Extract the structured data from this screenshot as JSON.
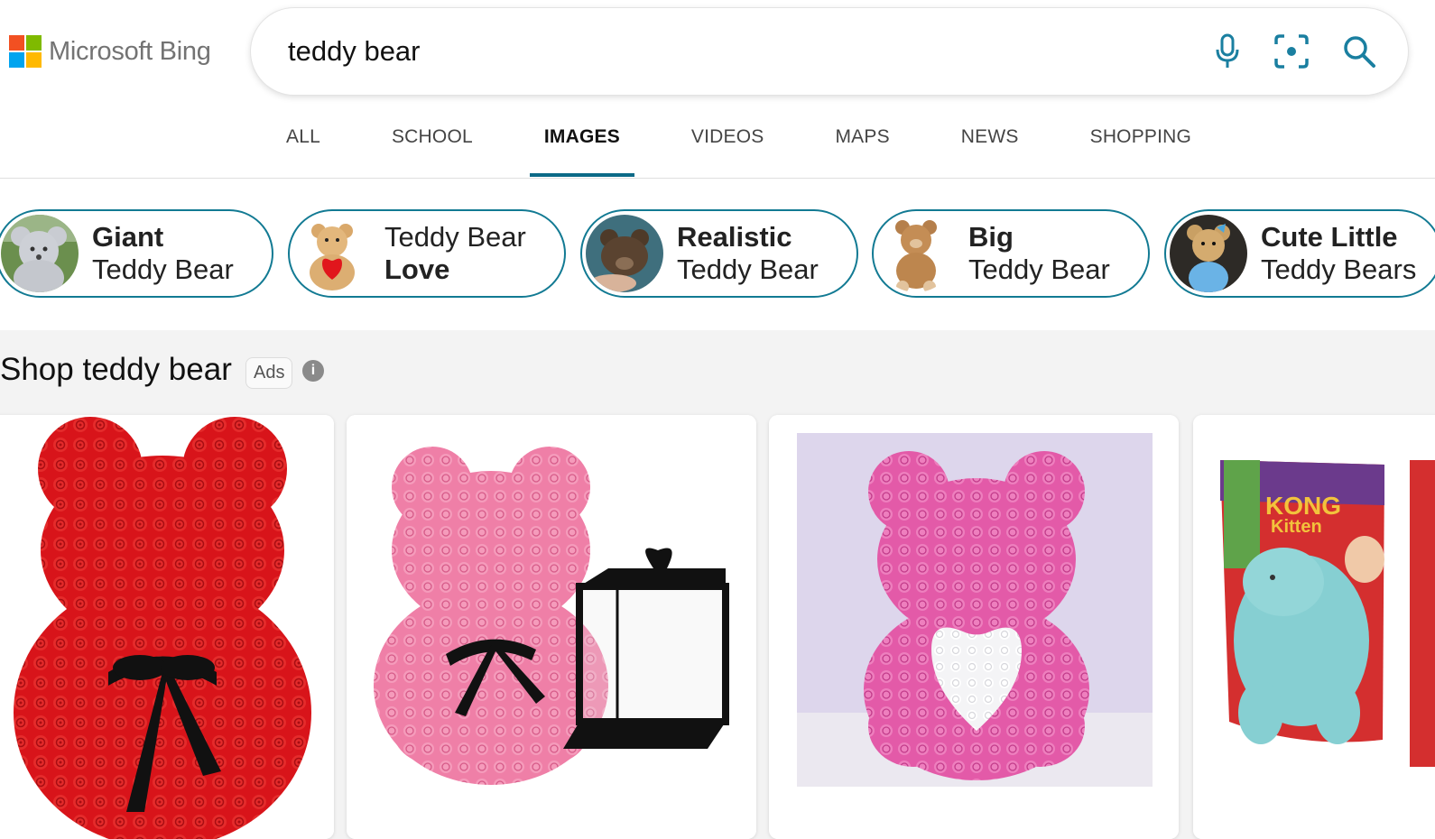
{
  "brand": {
    "name": "Microsoft Bing",
    "colors": [
      "#f25022",
      "#7fba00",
      "#00a4ef",
      "#ffb900"
    ]
  },
  "search": {
    "query": "teddy bear",
    "icons": [
      "microphone-icon",
      "visual-search-icon",
      "search-icon"
    ],
    "accent": "#1a7fa0"
  },
  "tabs": [
    {
      "label": "ALL",
      "active": false
    },
    {
      "label": "SCHOOL",
      "active": false
    },
    {
      "label": "IMAGES",
      "active": true
    },
    {
      "label": "VIDEOS",
      "active": false
    },
    {
      "label": "MAPS",
      "active": false
    },
    {
      "label": "NEWS",
      "active": false
    },
    {
      "label": "SHOPPING",
      "active": false
    }
  ],
  "related": [
    {
      "line1": "Giant",
      "line2": "Teddy Bear",
      "bold_line": 1
    },
    {
      "line1": "Teddy Bear",
      "line2": "Love",
      "bold_line": 2
    },
    {
      "line1": "Realistic",
      "line2": "Teddy Bear",
      "bold_line": 1
    },
    {
      "line1": "Big",
      "line2": "Teddy Bear",
      "bold_line": 1
    },
    {
      "line1": "Cute Little",
      "line2": "Teddy Bears",
      "bold_line": 1
    }
  ],
  "shopping": {
    "title": "Shop teddy bear",
    "ads_label": "Ads",
    "info_icon": "info-icon",
    "products": [
      {
        "image": "red rose teddy bear with black ribbon"
      },
      {
        "image": "pink rose teddy bear with black gift box"
      },
      {
        "image": "pink rose teddy bear with white heart"
      },
      {
        "image": "KONG Kitten plush toy in package"
      }
    ]
  },
  "chip_border_color": "#127a93"
}
